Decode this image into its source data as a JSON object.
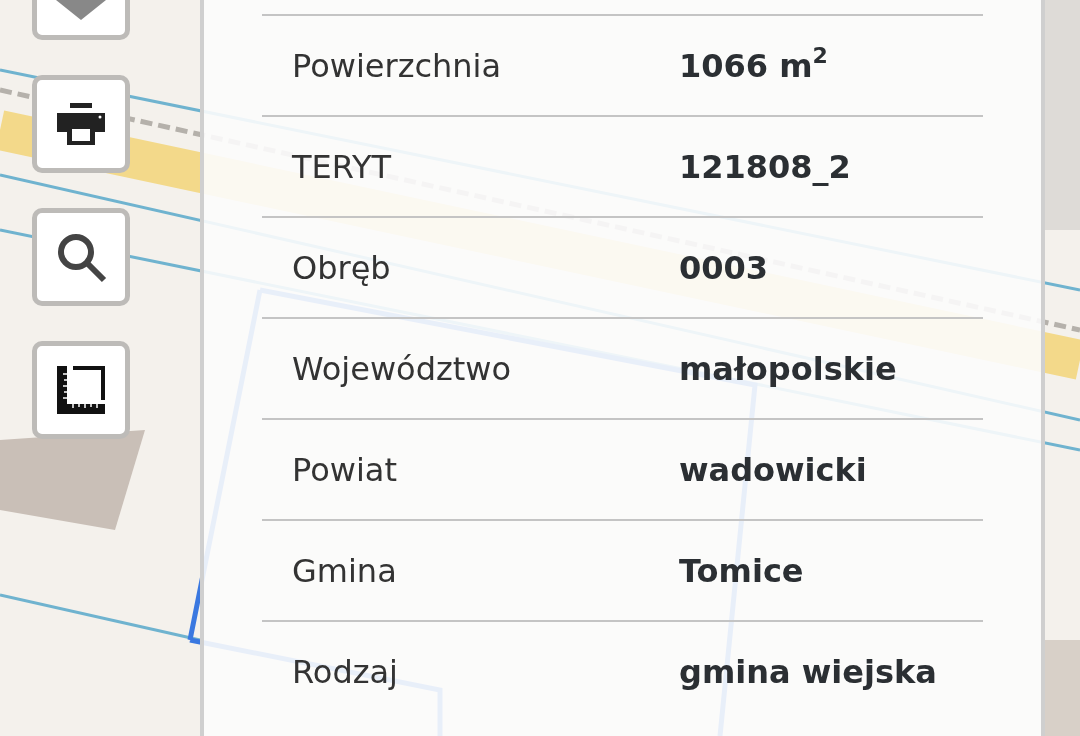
{
  "toolbar": {
    "buttons": [
      {
        "kind": "collapse"
      },
      {
        "kind": "print"
      },
      {
        "kind": "search"
      },
      {
        "kind": "measure"
      }
    ]
  },
  "details": {
    "rows": [
      {
        "label": "Powierzchnia",
        "value": "1066 m$^{2}$"
      },
      {
        "label": "TERYT",
        "value": "121808_2"
      },
      {
        "label": "Obręb",
        "value": "0003"
      },
      {
        "label": "Województwo",
        "value": "małopolskie"
      },
      {
        "label": "Powiat",
        "value": "wadowicki"
      },
      {
        "label": "Gmina",
        "value": "Tomice"
      },
      {
        "label": "Rodzaj",
        "value": "gmina wiejska"
      }
    ]
  }
}
